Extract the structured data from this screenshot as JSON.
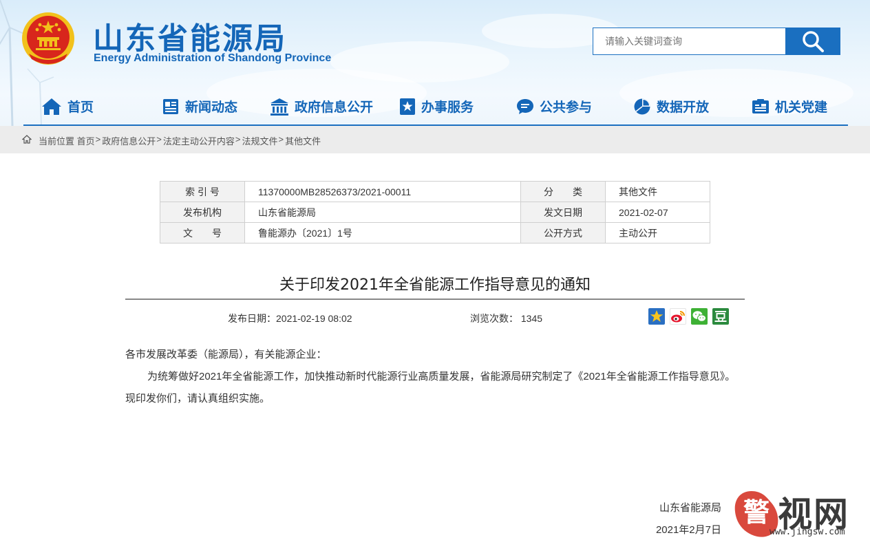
{
  "header": {
    "title": "山东省能源局",
    "subtitle": "Energy Administration of Shandong Province",
    "search_placeholder": "请输入关键词查询"
  },
  "nav": [
    {
      "label": "首页",
      "icon": "home-icon"
    },
    {
      "label": "新闻动态",
      "icon": "news-icon"
    },
    {
      "label": "政府信息公开",
      "icon": "government-building-icon"
    },
    {
      "label": "办事服务",
      "icon": "star-bookmark-icon"
    },
    {
      "label": "公共参与",
      "icon": "chat-bubble-icon"
    },
    {
      "label": "数据开放",
      "icon": "pie-chart-icon"
    },
    {
      "label": "机关党建",
      "icon": "id-card-icon"
    }
  ],
  "breadcrumb": {
    "prefix": "当前位置",
    "items": [
      "首页",
      "政府信息公开",
      "法定主动公开内容",
      "法规文件",
      "其他文件"
    ],
    "separator": ">"
  },
  "meta": {
    "rows": [
      {
        "k1": "索 引 号",
        "v1": "11370000MB28526373/2021-00011",
        "k2": "分　　类",
        "v2": "其他文件"
      },
      {
        "k1": "发布机构",
        "v1": "山东省能源局",
        "k2": "发文日期",
        "v2": "2021-02-07"
      },
      {
        "k1": "文　　号",
        "v1": "鲁能源办〔2021〕1号",
        "k2": "公开方式",
        "v2": "主动公开"
      }
    ]
  },
  "article": {
    "title": "关于印发2021年全省能源工作指导意见的通知",
    "publish_date": "发布日期：2021-02-19 08:02",
    "views": "浏览次数：  1345",
    "share_icons": [
      "qzone-icon",
      "weibo-icon",
      "wechat-icon",
      "douban-icon"
    ],
    "salutation": "各市发展改革委（能源局），有关能源企业：",
    "paragraph": "为统筹做好2021年全省能源工作，加快推动新时代能源行业高质量发展，省能源局研究制定了《2021年全省能源工作指导意见》。现印发你们，请认真组织实施。",
    "signer": "山东省能源局",
    "sign_date": "2021年2月7日"
  },
  "watermark": {
    "chars": "视网",
    "url": "www.jingsw.com"
  },
  "colors": {
    "brand_blue": "#1466b8",
    "accent_blue": "#1a6fc0",
    "crumb_bg": "#ececec",
    "emblem_red": "#d8261c",
    "emblem_gold": "#f2c11b"
  }
}
